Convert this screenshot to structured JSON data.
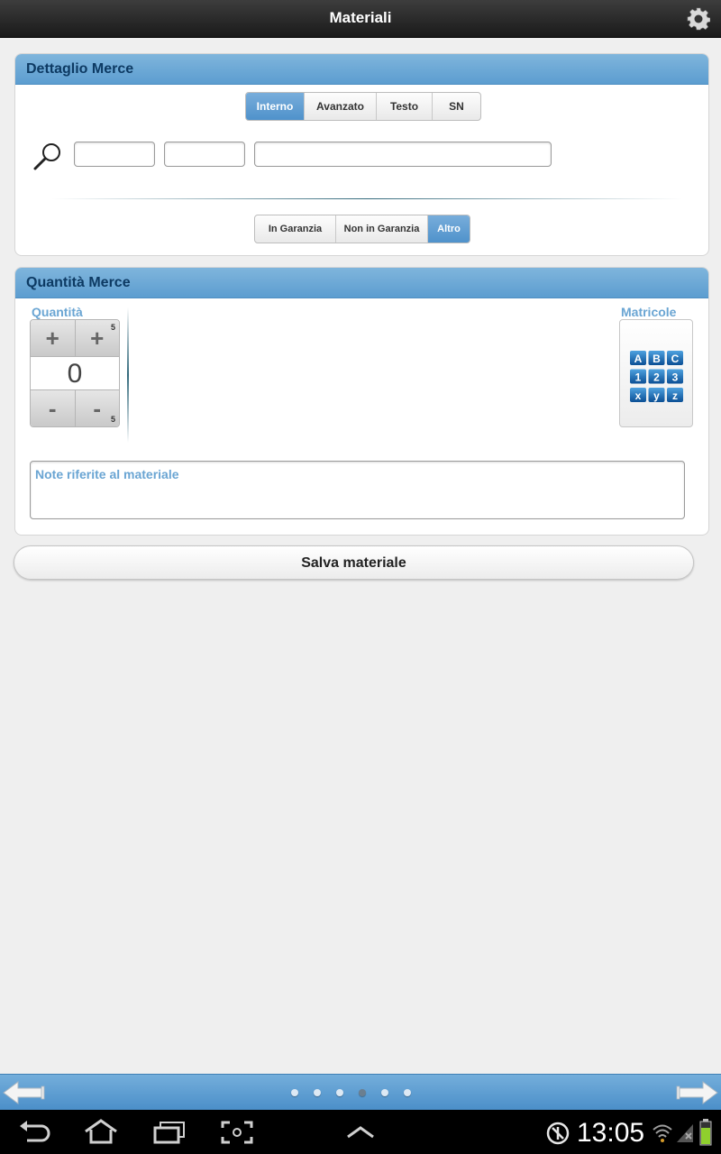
{
  "header": {
    "title": "Materiali",
    "settings_icon": "gear-icon"
  },
  "dettaglio": {
    "title": "Dettaglio Merce",
    "search_tabs": [
      {
        "label": "Interno",
        "active": true
      },
      {
        "label": "Avanzato",
        "active": false
      },
      {
        "label": "Testo",
        "active": false
      },
      {
        "label": "SN",
        "active": false
      }
    ],
    "fields": {
      "field1": "",
      "field2": "",
      "field3": ""
    },
    "warranty_tabs": [
      {
        "label": "In Garanzia",
        "active": false
      },
      {
        "label": "Non in Garanzia",
        "active": false
      },
      {
        "label": "Altro",
        "active": true
      }
    ]
  },
  "quantita": {
    "title": "Quantità Merce",
    "qty_label": "Quantità",
    "plus": "+",
    "minus": "-",
    "step": "5",
    "value": "0",
    "matricole_label": "Matricole",
    "keys": [
      "A",
      "B",
      "C",
      "1",
      "2",
      "3",
      "x",
      "y",
      "z"
    ],
    "notes_placeholder": "Note riferite al materiale"
  },
  "save_label": "Salva materiale",
  "pager": {
    "pages": 6,
    "current": 4
  },
  "system": {
    "time": "13:05"
  },
  "colors": {
    "accent": "#5c9dd0",
    "header": "#2a2a2a",
    "label_blue": "#6aa5d3"
  }
}
